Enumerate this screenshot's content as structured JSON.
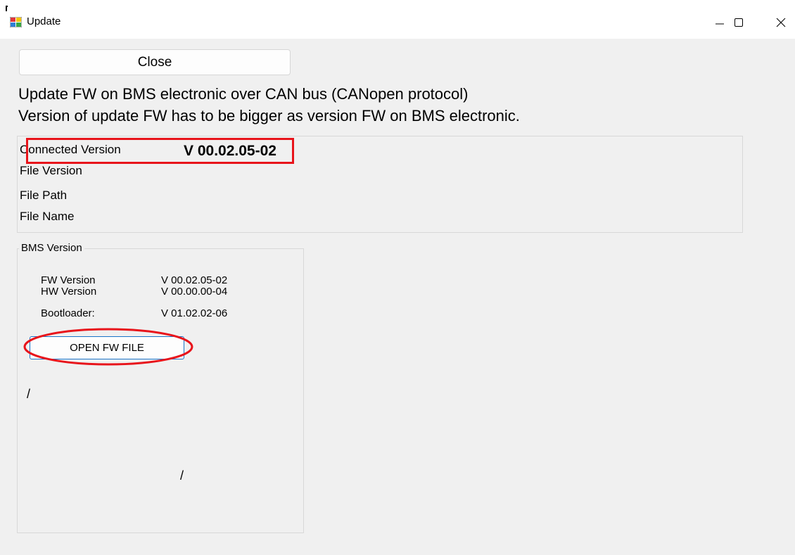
{
  "window": {
    "title": "Update",
    "app_icon": "winforms-app-icon",
    "controls": {
      "minimize_icon": "minimize-icon",
      "maximize_icon": "maximize-icon",
      "close_icon": "close-icon"
    }
  },
  "actions": {
    "close_label": "Close"
  },
  "headline": {
    "line1": "Update FW on BMS electronic over CAN bus (CANopen protocol)",
    "line2": "Version of update FW has to be bigger as version FW on BMS electronic."
  },
  "info": {
    "connected_version_label": "Connected Version",
    "connected_version_value": "V 00.02.05-02",
    "file_version_label": "File Version",
    "file_path_label": "File Path",
    "file_name_label": "File Name"
  },
  "bms_version": {
    "group_title": "BMS Version",
    "fw_label": "FW Version",
    "fw_value": "V 00.02.05-02",
    "hw_label": "HW Version",
    "hw_value": "V 00.00.00-04",
    "bootloader_label": "Bootloader:",
    "bootloader_value": "V 01.02.02-06",
    "open_button_label": "OPEN FW FILE",
    "slash_1": "/",
    "slash_2": "/"
  },
  "annotations": {
    "highlight_color": "#e8141b"
  },
  "colors": {
    "window_bg": "#f0f0f0",
    "titlebar_bg": "#ffffff",
    "button_focus_border": "#1a73c8"
  }
}
